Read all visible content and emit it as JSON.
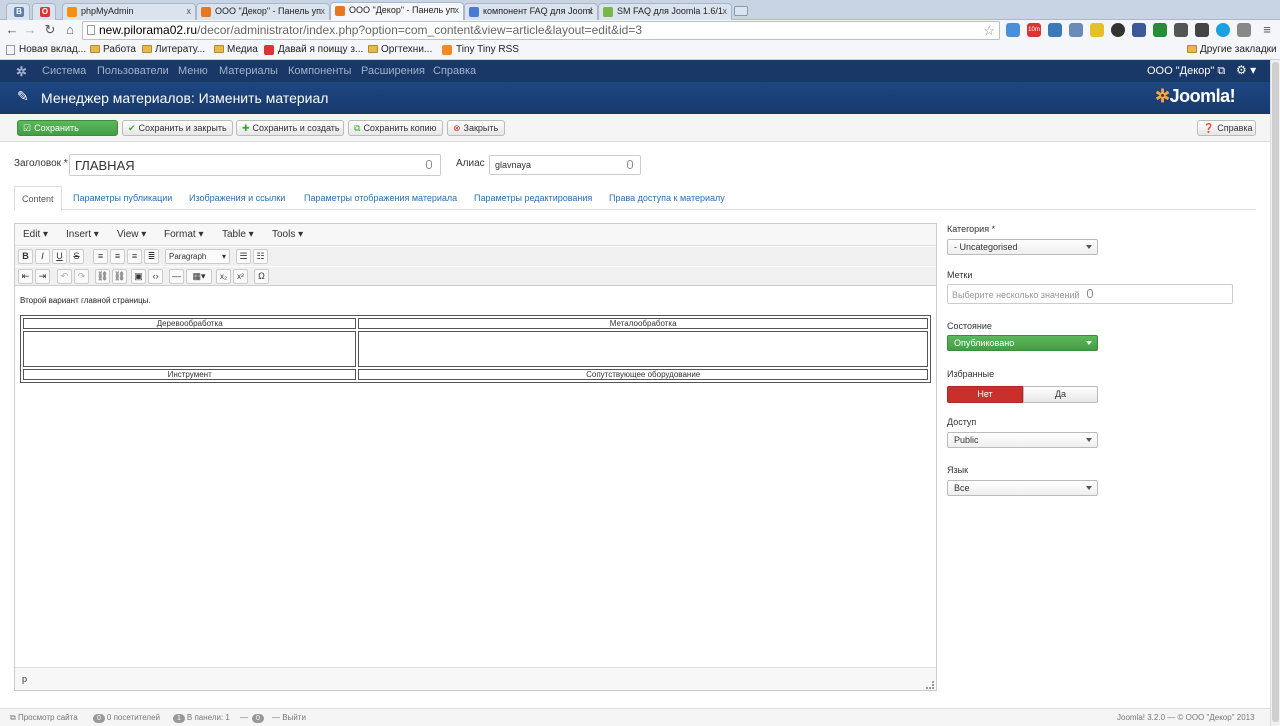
{
  "browser": {
    "pinned": [
      {
        "icon": "vk-icon",
        "letter": "B",
        "color": "#5b7fa6"
      },
      {
        "icon": "opera-icon",
        "letter": "O",
        "color": "#d33"
      }
    ],
    "tabs": [
      {
        "label": "phpMyAdmin",
        "color": "#f29111"
      },
      {
        "label": "ООО \"Декор\" - Панель уп",
        "color": "#e87722"
      },
      {
        "label": "ООО \"Декор\" - Панель уп",
        "color": "#e87722",
        "active": true
      },
      {
        "label": "компонент FAQ для Jooml",
        "color": "#4a7bd4"
      },
      {
        "label": "SM FAQ для Joomla 1.6/1",
        "color": "#7ab648"
      }
    ],
    "close_glyph": "x",
    "url_domain": "new.pilorama02.ru",
    "url_path": "/decor/administrator/index.php?option=com_content&view=article&layout=edit&id=3",
    "bookmarks": [
      {
        "label": "Новая вклад..."
      },
      {
        "label": "Работа",
        "folder": true
      },
      {
        "label": "Литерату...",
        "folder": true
      },
      {
        "label": "Медиа",
        "folder": true
      },
      {
        "label": "Давай я поищу з..."
      },
      {
        "label": "Оргтехни...",
        "folder": true
      },
      {
        "label": "Tiny Tiny RSS"
      }
    ],
    "other_bookmarks": "Другие закладки",
    "badge_10m": "10m"
  },
  "admin": {
    "menu": [
      "Система",
      "Пользователи",
      "Меню",
      "Материалы",
      "Компоненты",
      "Расширения",
      "Справка"
    ],
    "site_name": "ООО \"Декор\"",
    "page_title": "Менеджер материалов: Изменить материал",
    "logo_text": "Joomla!"
  },
  "toolbar": {
    "save": "Сохранить",
    "save_close": "Сохранить и закрыть",
    "save_new": "Сохранить и создать",
    "save_copy": "Сохранить копию",
    "close": "Закрыть",
    "help": "Справка"
  },
  "form": {
    "title_label": "Заголовок *",
    "title_value": "ГЛАВНАЯ",
    "alias_label": "Алиас",
    "alias_value": "glavnaya"
  },
  "tabs": [
    "Content",
    "Параметры публикации",
    "Изображения и ссылки",
    "Параметры отображения материала",
    "Параметры редактирования",
    "Права доступа к материалу"
  ],
  "editor": {
    "menu": [
      "Edit",
      "Insert",
      "View",
      "Format",
      "Table",
      "Tools"
    ],
    "format_select": "Paragraph",
    "intro_text": "Второй вариант главной страницы.",
    "table": {
      "header_left": "Деревообработка",
      "header_right": "Металообработка",
      "footer_left": "Инструмент",
      "footer_right": "Сопутствующее оборудование"
    },
    "path": "p"
  },
  "sidebar": {
    "category_label": "Категория *",
    "category_value": "- Uncategorised",
    "tags_label": "Метки",
    "tags_placeholder": "Выберите несколько значений",
    "state_label": "Состояние",
    "state_value": "Опубликовано",
    "featured_label": "Избранные",
    "featured_no": "Нет",
    "featured_yes": "Да",
    "access_label": "Доступ",
    "access_value": "Public",
    "language_label": "Язык",
    "language_value": "Все"
  },
  "footer": {
    "view_site": "Просмотр сайта",
    "visitors_count": "0",
    "visitors_label": "0 посетителей",
    "admins_count": "1",
    "admins_label": "В панели: 1",
    "separator": "—",
    "messages_count": "0",
    "logout": "Выйти",
    "copyright": "Joomla! 3.2.0  —  © ООО \"Декор\" 2013"
  },
  "colors": {
    "admin_nav": "#1a3867",
    "title_bar": "#1e4682",
    "save_green": "#5cb85c",
    "link_blue": "#2a6fb5",
    "no_red": "#c9302c"
  }
}
